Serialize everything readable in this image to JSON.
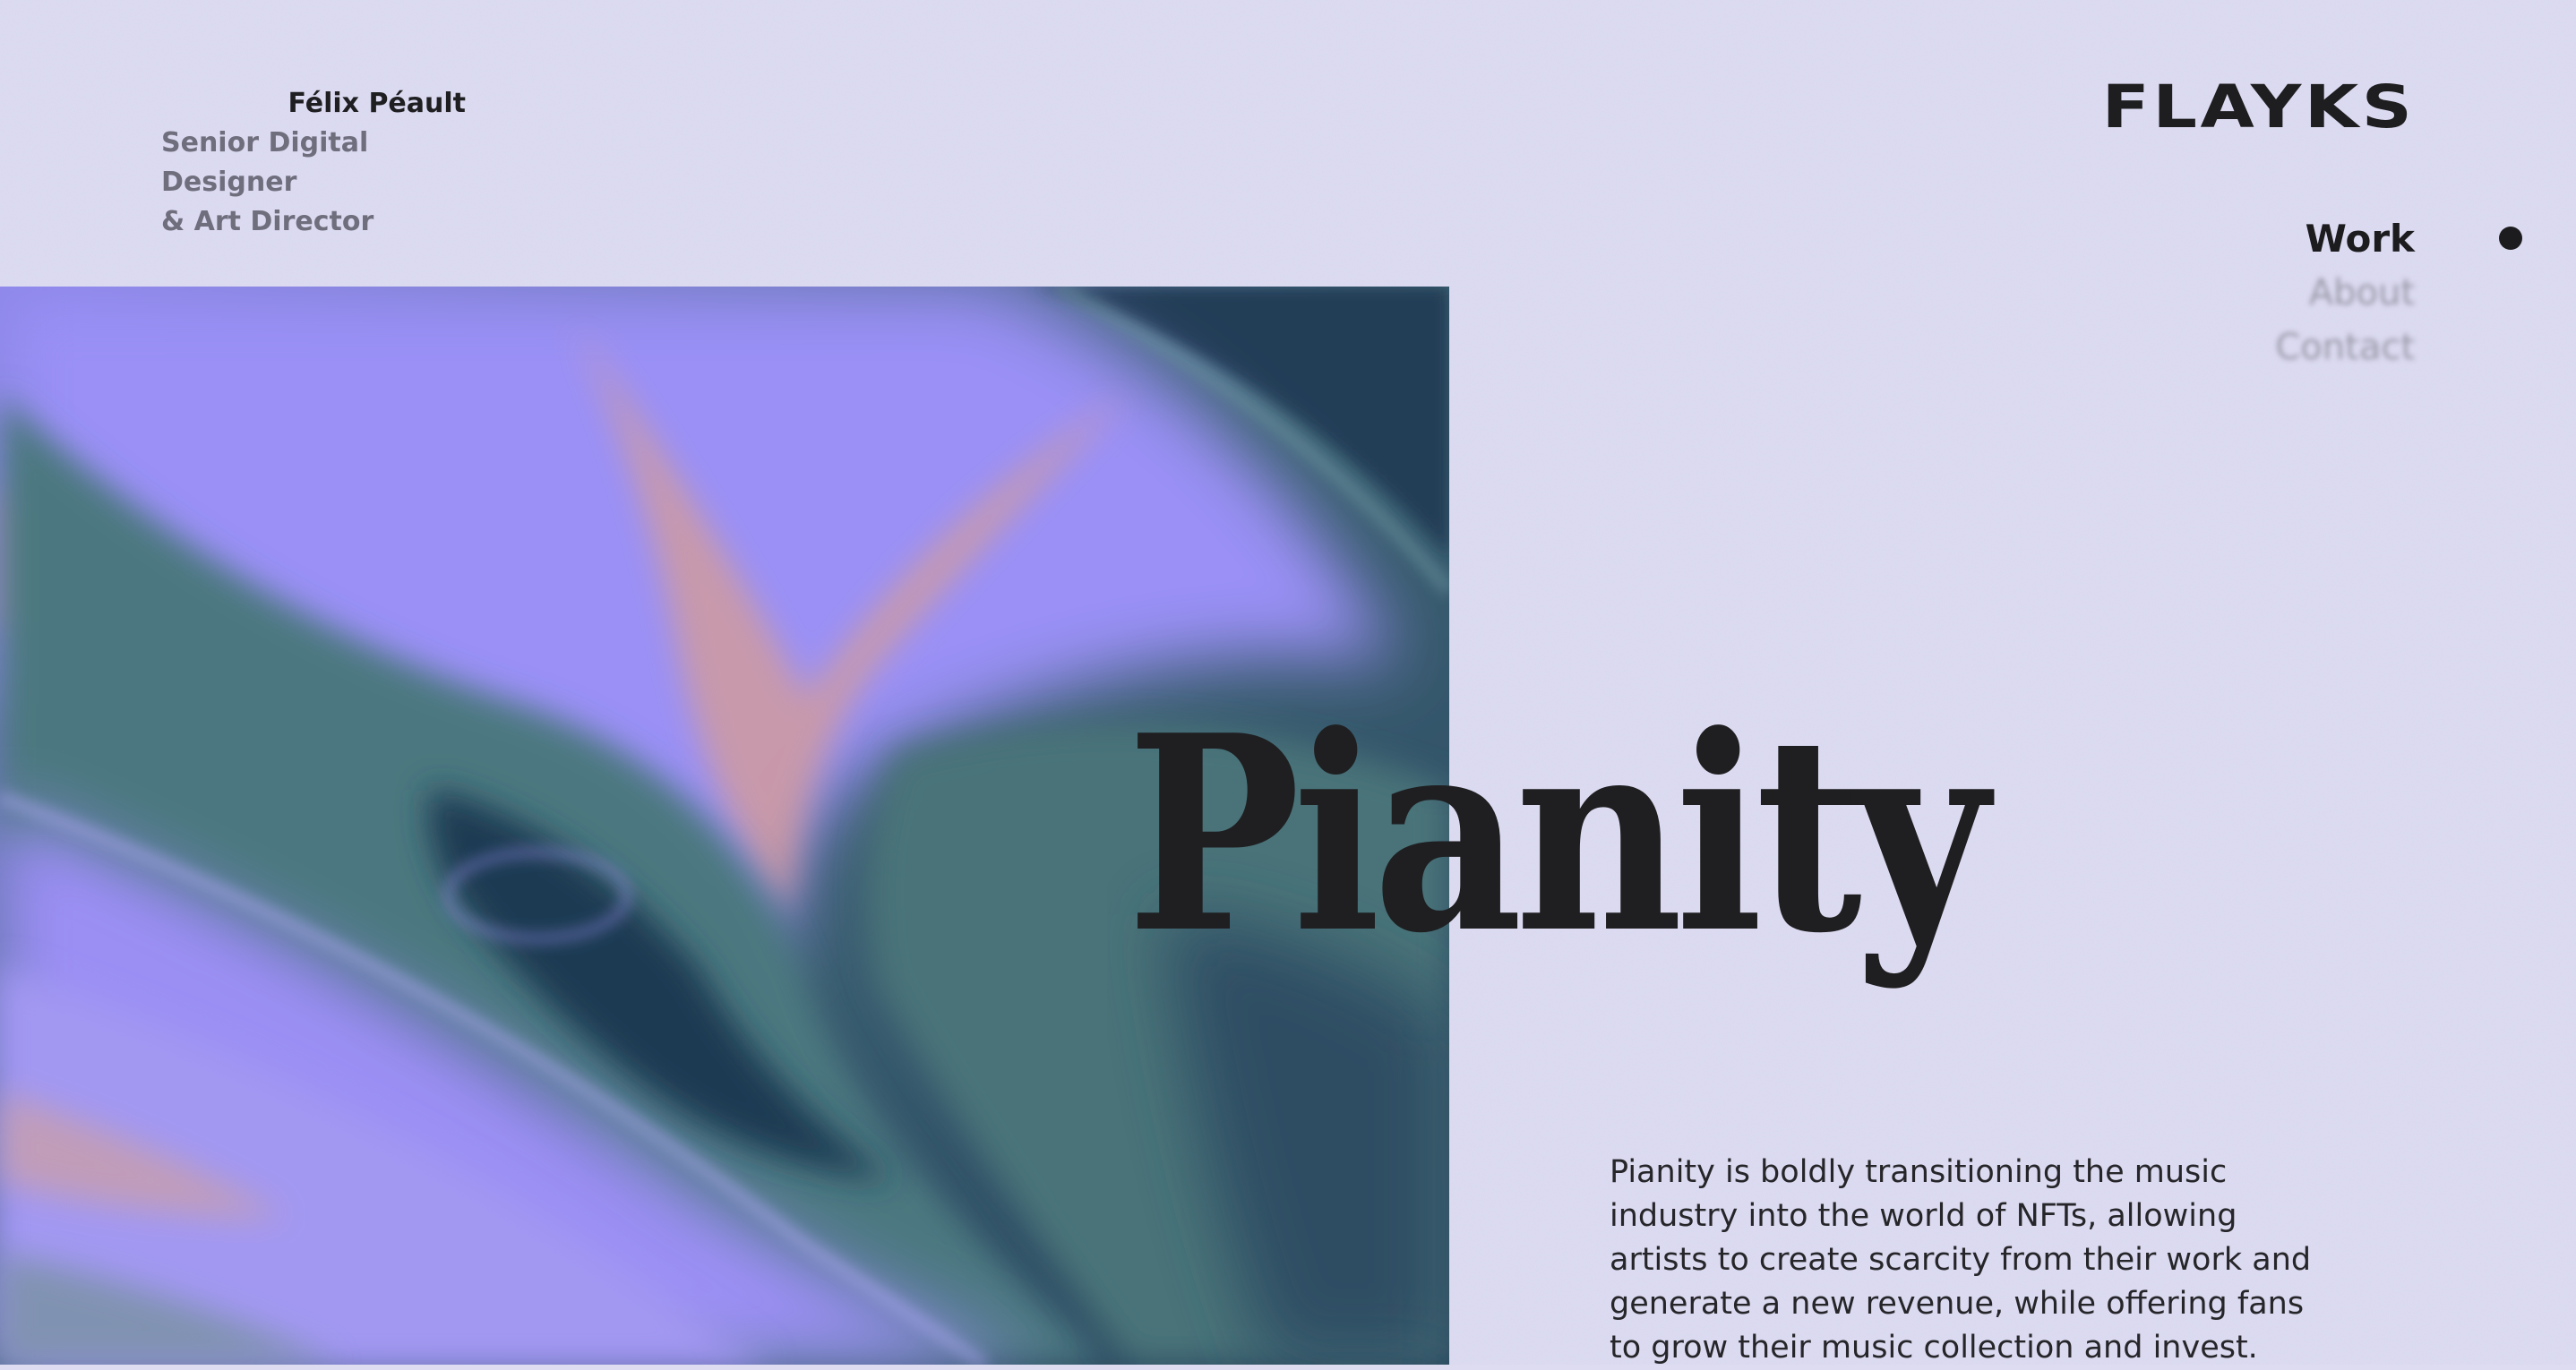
{
  "author": {
    "name": "Félix Péault",
    "role_line1": "Senior Digital Designer",
    "role_line2": "& Art Director"
  },
  "logo": {
    "text": "FLAYKS"
  },
  "nav": {
    "items": [
      {
        "label": "Work",
        "active": true
      },
      {
        "label": "About",
        "active": false
      },
      {
        "label": "Contact",
        "active": false
      }
    ]
  },
  "project": {
    "title": "Pianity",
    "description": "Pianity is boldly transitioning the music industry into the world of NFTs, allowing artists to create scarcity from their work and generate a new revenue, while offering fans to grow their music collection and invest."
  },
  "colors": {
    "background": "#dddcf1",
    "text_dark": "#1f1f21",
    "text_muted": "#6f6e7d",
    "image_lavender": "#9a8ff5",
    "image_teal": "#4f7a80",
    "image_navy": "#213c57",
    "image_peach": "#d9a090"
  },
  "icons": {
    "active_indicator": "filled-circle"
  }
}
